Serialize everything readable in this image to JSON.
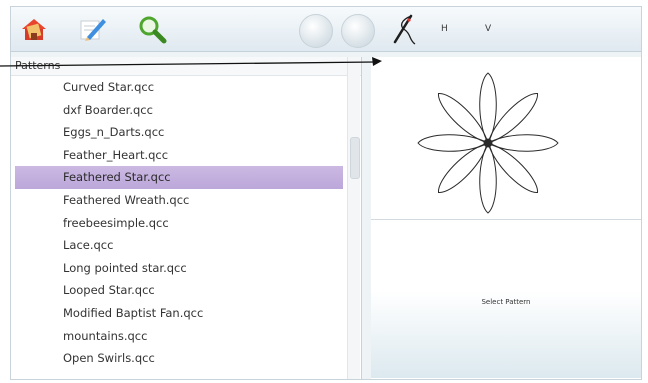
{
  "toolbar": {
    "h_label": "H",
    "v_label": "V",
    "icons": [
      "home-book-icon",
      "edit-pencil-icon",
      "search-magnifier-icon",
      "needle-thread-icon"
    ]
  },
  "patterns": {
    "header": "Patterns",
    "items": [
      {
        "label": "Curved Star.qcc"
      },
      {
        "label": "dxf Boarder.qcc"
      },
      {
        "label": "Eggs_n_Darts.qcc"
      },
      {
        "label": "Feather_Heart.qcc"
      },
      {
        "label": "Feathered Star.qcc",
        "selected": true
      },
      {
        "label": "Feathered Wreath.qcc"
      },
      {
        "label": "freebeesimple.qcc"
      },
      {
        "label": "Lace.qcc"
      },
      {
        "label": "Long pointed  star.qcc"
      },
      {
        "label": "Looped Star.qcc"
      },
      {
        "label": "Modified Baptist Fan.qcc"
      },
      {
        "label": "mountains.qcc"
      },
      {
        "label": "Open Swirls.qcc"
      }
    ]
  },
  "preview": {
    "status": "Select Pattern"
  },
  "colors": {
    "selection": "#c4b1de",
    "toolbar_bg": "#e6eef3"
  }
}
